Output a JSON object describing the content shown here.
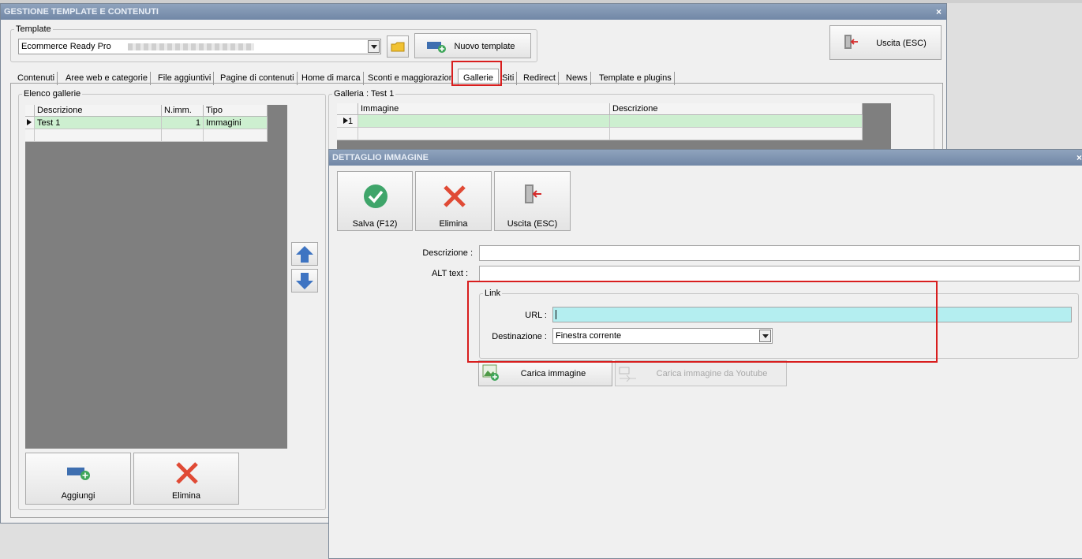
{
  "main_window": {
    "title": "GESTIONE TEMPLATE E CONTENUTI",
    "close_glyph": "×",
    "template_group_label": "Template",
    "template_value": "Ecommerce Ready Pro",
    "new_template_label": "Nuovo template",
    "exit_label": "Uscita (ESC)"
  },
  "tabs": [
    "Contenuti",
    "Aree web e categorie",
    "File aggiuntivi",
    "Pagine di contenuti",
    "Home di marca",
    "Sconti e maggiorazioni",
    "Gallerie",
    "Siti",
    "Redirect",
    "News",
    "Template e plugins"
  ],
  "galleries": {
    "group_label": "Elenco gallerie",
    "columns": [
      "Descrizione",
      "N.imm.",
      "Tipo"
    ],
    "rows": [
      {
        "descrizione": "Test 1",
        "n_imm": "1",
        "tipo": "Immagini"
      }
    ],
    "add_label": "Aggiungi",
    "delete_label": "Elimina"
  },
  "gallery_detail": {
    "group_label": "Galleria : Test 1",
    "columns": [
      "Immagine",
      "Descrizione"
    ],
    "row_number": "1"
  },
  "dialog": {
    "title": "DETTAGLIO IMMAGINE",
    "save_label": "Salva (F12)",
    "delete_label": "Elimina",
    "exit_label": "Uscita (ESC)",
    "descrizione_label": "Descrizione :",
    "alt_label": "ALT text :",
    "link_group_label": "Link",
    "url_label": "URL :",
    "destinazione_label": "Destinazione :",
    "destinazione_value": "Finestra corrente",
    "load_image_label": "Carica immagine",
    "load_youtube_label": "Carica immagine da Youtube"
  },
  "colors": {
    "highlight": "#d81e1e",
    "selected_row": "#cdefd0",
    "url_field": "#b4eef0",
    "title_bar": "#8fa3bd"
  }
}
